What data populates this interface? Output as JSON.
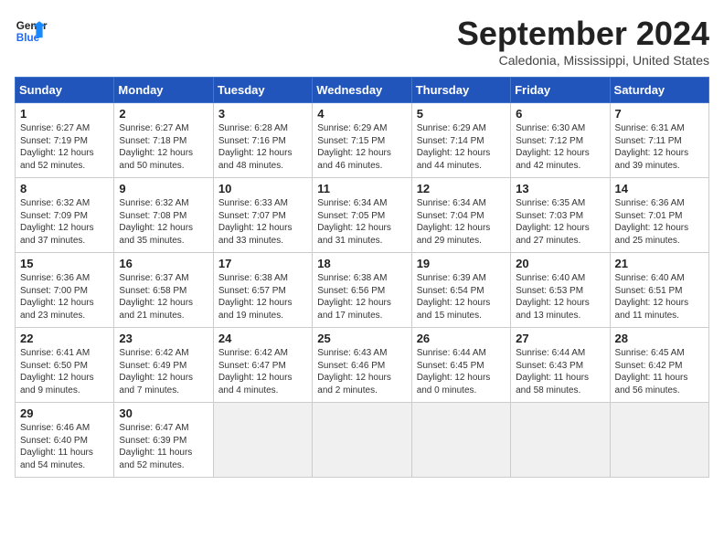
{
  "header": {
    "logo_line1": "General",
    "logo_line2": "Blue",
    "month_title": "September 2024",
    "location": "Caledonia, Mississippi, United States"
  },
  "weekdays": [
    "Sunday",
    "Monday",
    "Tuesday",
    "Wednesday",
    "Thursday",
    "Friday",
    "Saturday"
  ],
  "weeks": [
    [
      {
        "day": "1",
        "info": "Sunrise: 6:27 AM\nSunset: 7:19 PM\nDaylight: 12 hours\nand 52 minutes."
      },
      {
        "day": "2",
        "info": "Sunrise: 6:27 AM\nSunset: 7:18 PM\nDaylight: 12 hours\nand 50 minutes."
      },
      {
        "day": "3",
        "info": "Sunrise: 6:28 AM\nSunset: 7:16 PM\nDaylight: 12 hours\nand 48 minutes."
      },
      {
        "day": "4",
        "info": "Sunrise: 6:29 AM\nSunset: 7:15 PM\nDaylight: 12 hours\nand 46 minutes."
      },
      {
        "day": "5",
        "info": "Sunrise: 6:29 AM\nSunset: 7:14 PM\nDaylight: 12 hours\nand 44 minutes."
      },
      {
        "day": "6",
        "info": "Sunrise: 6:30 AM\nSunset: 7:12 PM\nDaylight: 12 hours\nand 42 minutes."
      },
      {
        "day": "7",
        "info": "Sunrise: 6:31 AM\nSunset: 7:11 PM\nDaylight: 12 hours\nand 39 minutes."
      }
    ],
    [
      {
        "day": "8",
        "info": "Sunrise: 6:32 AM\nSunset: 7:09 PM\nDaylight: 12 hours\nand 37 minutes."
      },
      {
        "day": "9",
        "info": "Sunrise: 6:32 AM\nSunset: 7:08 PM\nDaylight: 12 hours\nand 35 minutes."
      },
      {
        "day": "10",
        "info": "Sunrise: 6:33 AM\nSunset: 7:07 PM\nDaylight: 12 hours\nand 33 minutes."
      },
      {
        "day": "11",
        "info": "Sunrise: 6:34 AM\nSunset: 7:05 PM\nDaylight: 12 hours\nand 31 minutes."
      },
      {
        "day": "12",
        "info": "Sunrise: 6:34 AM\nSunset: 7:04 PM\nDaylight: 12 hours\nand 29 minutes."
      },
      {
        "day": "13",
        "info": "Sunrise: 6:35 AM\nSunset: 7:03 PM\nDaylight: 12 hours\nand 27 minutes."
      },
      {
        "day": "14",
        "info": "Sunrise: 6:36 AM\nSunset: 7:01 PM\nDaylight: 12 hours\nand 25 minutes."
      }
    ],
    [
      {
        "day": "15",
        "info": "Sunrise: 6:36 AM\nSunset: 7:00 PM\nDaylight: 12 hours\nand 23 minutes."
      },
      {
        "day": "16",
        "info": "Sunrise: 6:37 AM\nSunset: 6:58 PM\nDaylight: 12 hours\nand 21 minutes."
      },
      {
        "day": "17",
        "info": "Sunrise: 6:38 AM\nSunset: 6:57 PM\nDaylight: 12 hours\nand 19 minutes."
      },
      {
        "day": "18",
        "info": "Sunrise: 6:38 AM\nSunset: 6:56 PM\nDaylight: 12 hours\nand 17 minutes."
      },
      {
        "day": "19",
        "info": "Sunrise: 6:39 AM\nSunset: 6:54 PM\nDaylight: 12 hours\nand 15 minutes."
      },
      {
        "day": "20",
        "info": "Sunrise: 6:40 AM\nSunset: 6:53 PM\nDaylight: 12 hours\nand 13 minutes."
      },
      {
        "day": "21",
        "info": "Sunrise: 6:40 AM\nSunset: 6:51 PM\nDaylight: 12 hours\nand 11 minutes."
      }
    ],
    [
      {
        "day": "22",
        "info": "Sunrise: 6:41 AM\nSunset: 6:50 PM\nDaylight: 12 hours\nand 9 minutes."
      },
      {
        "day": "23",
        "info": "Sunrise: 6:42 AM\nSunset: 6:49 PM\nDaylight: 12 hours\nand 7 minutes."
      },
      {
        "day": "24",
        "info": "Sunrise: 6:42 AM\nSunset: 6:47 PM\nDaylight: 12 hours\nand 4 minutes."
      },
      {
        "day": "25",
        "info": "Sunrise: 6:43 AM\nSunset: 6:46 PM\nDaylight: 12 hours\nand 2 minutes."
      },
      {
        "day": "26",
        "info": "Sunrise: 6:44 AM\nSunset: 6:45 PM\nDaylight: 12 hours\nand 0 minutes."
      },
      {
        "day": "27",
        "info": "Sunrise: 6:44 AM\nSunset: 6:43 PM\nDaylight: 11 hours\nand 58 minutes."
      },
      {
        "day": "28",
        "info": "Sunrise: 6:45 AM\nSunset: 6:42 PM\nDaylight: 11 hours\nand 56 minutes."
      }
    ],
    [
      {
        "day": "29",
        "info": "Sunrise: 6:46 AM\nSunset: 6:40 PM\nDaylight: 11 hours\nand 54 minutes."
      },
      {
        "day": "30",
        "info": "Sunrise: 6:47 AM\nSunset: 6:39 PM\nDaylight: 11 hours\nand 52 minutes."
      },
      {
        "day": "",
        "info": ""
      },
      {
        "day": "",
        "info": ""
      },
      {
        "day": "",
        "info": ""
      },
      {
        "day": "",
        "info": ""
      },
      {
        "day": "",
        "info": ""
      }
    ]
  ]
}
